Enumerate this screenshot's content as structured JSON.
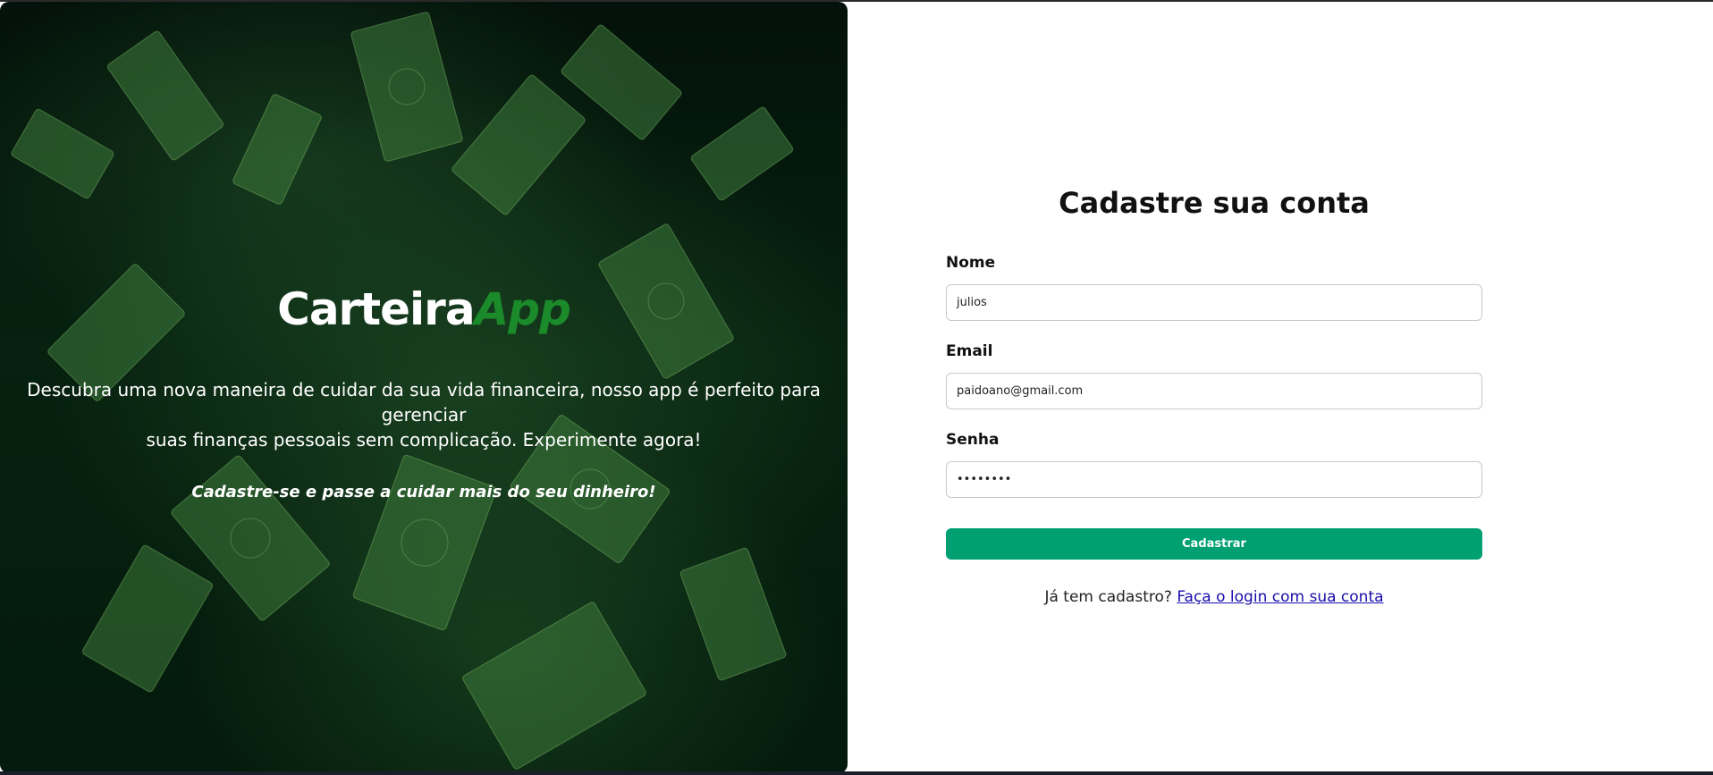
{
  "hero": {
    "brand_main": "Carteira",
    "brand_accent": "App",
    "tagline_line1": "Descubra uma nova maneira de cuidar da sua vida financeira, nosso app é perfeito para gerenciar",
    "tagline_line2": "suas finanças pessoais sem complicação. Experimente agora!",
    "cta_text": "Cadastre-se e passe a cuidar mais do seu dinheiro!"
  },
  "form": {
    "title": "Cadastre sua conta",
    "fields": [
      {
        "label": "Nome",
        "value": "julios"
      },
      {
        "label": "Email",
        "value": "paidoano@gmail.com"
      },
      {
        "label": "Senha",
        "value": "••••••••"
      }
    ],
    "submit_label": "Cadastrar",
    "login_prompt": "Já tem cadastro?",
    "login_link": "Faça o login com sua conta"
  },
  "colors": {
    "accent_green": "#1b8a2a",
    "button_green": "#00a072",
    "link_blue": "#1a0dab"
  }
}
